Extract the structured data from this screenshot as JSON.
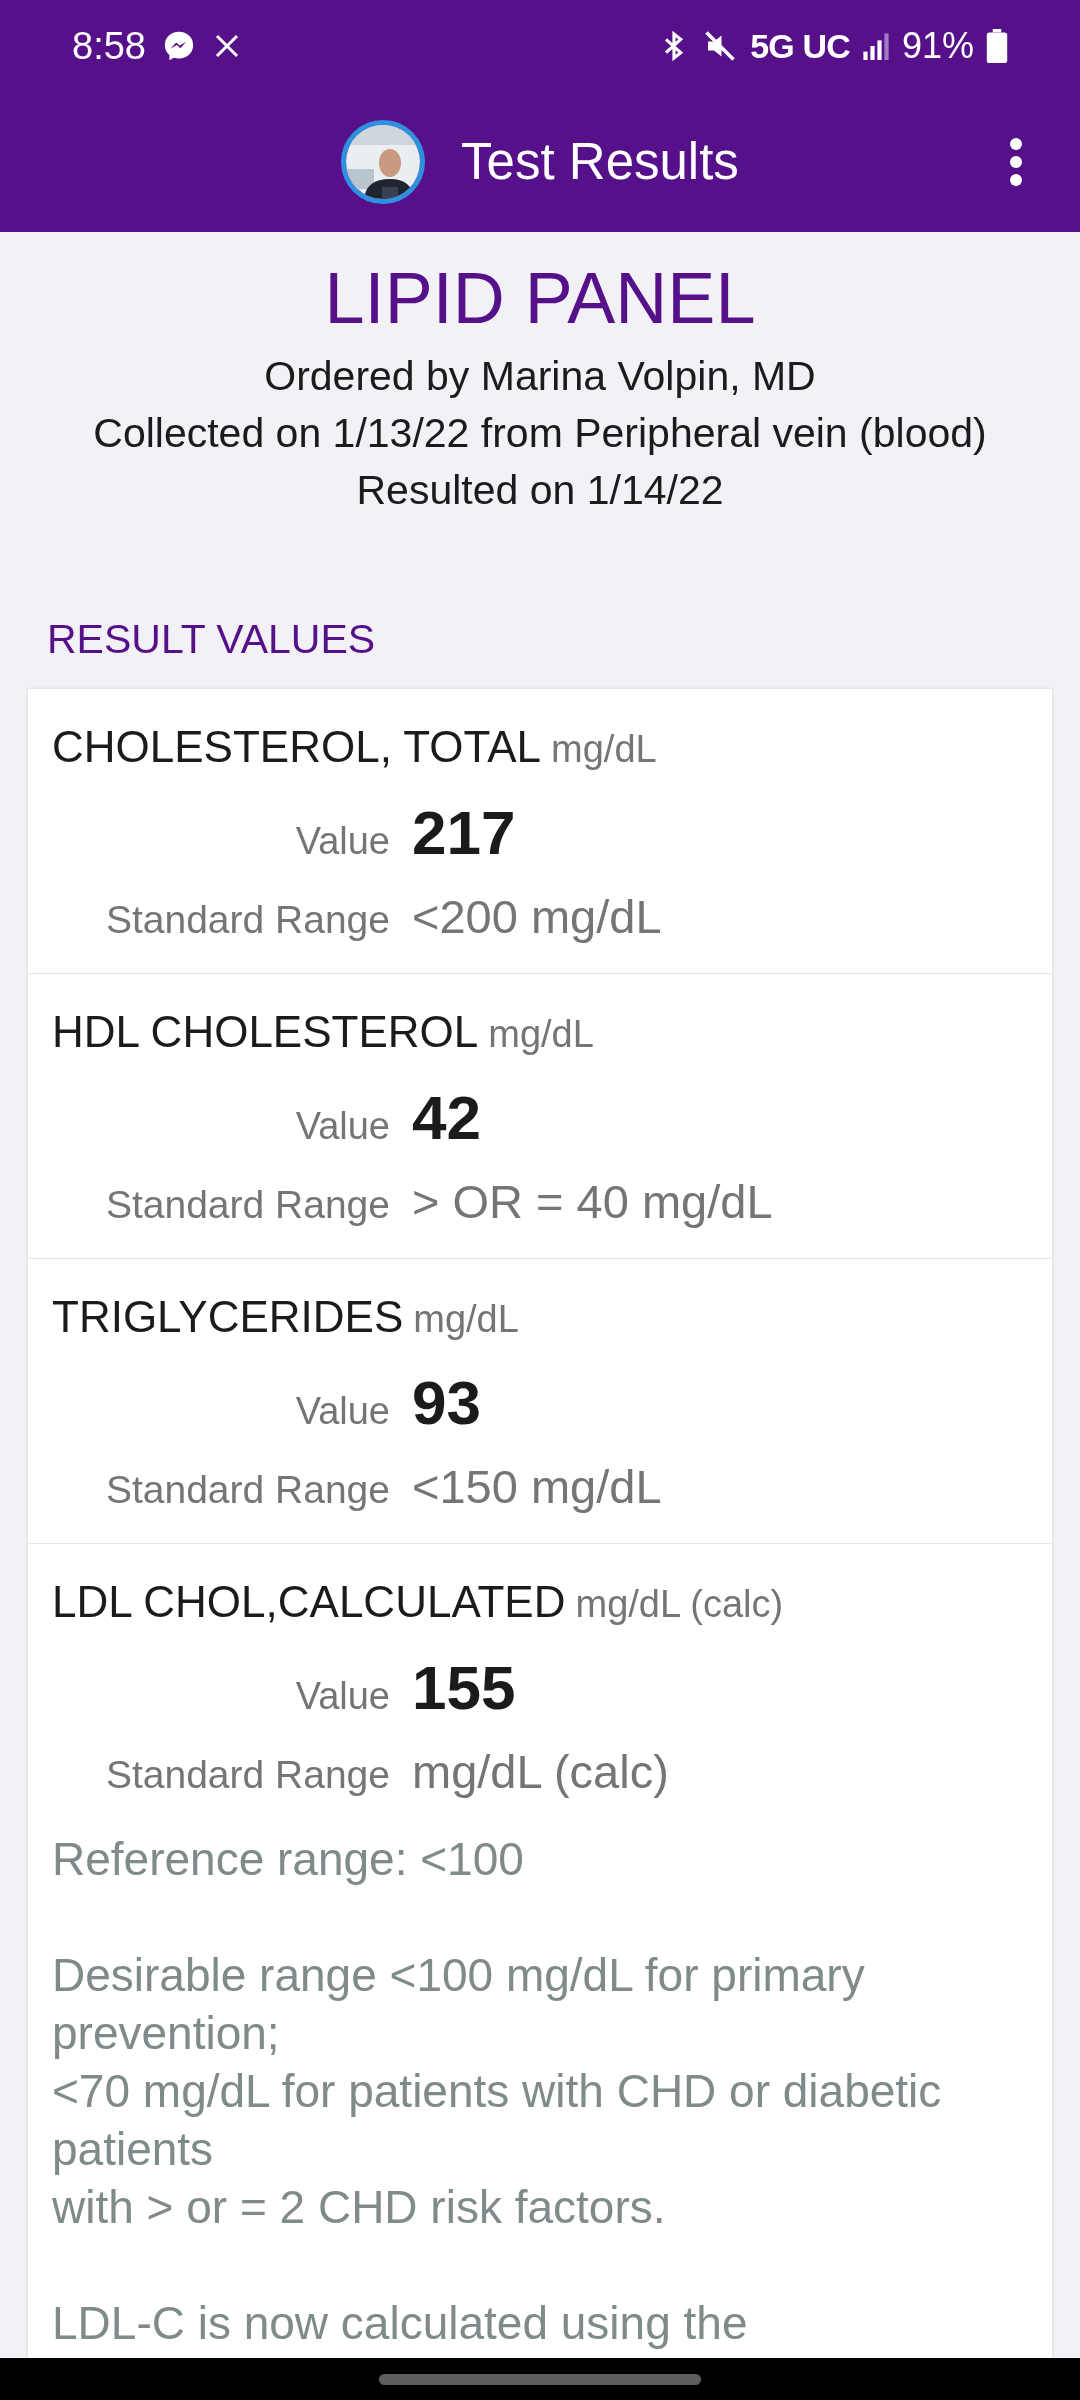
{
  "status_bar": {
    "time": "8:58",
    "network": "5G UC",
    "battery": "91%"
  },
  "app_bar": {
    "title": "Test Results"
  },
  "panel": {
    "title": "LIPID PANEL",
    "lines": [
      "Ordered by Marina Volpin, MD",
      "Collected on 1/13/22 from Peripheral vein (blood)",
      "Resulted on 1/14/22"
    ]
  },
  "section_heading": "RESULT VALUES",
  "results": [
    {
      "name": "CHOLESTEROL, TOTAL",
      "unit": "mg/dL",
      "value_label": "Value",
      "value": "217",
      "range_label": "Standard Range",
      "range": "<200 mg/dL"
    },
    {
      "name": "HDL CHOLESTEROL",
      "unit": "mg/dL",
      "value_label": "Value",
      "value": "42",
      "range_label": "Standard Range",
      "range": "> OR = 40 mg/dL"
    },
    {
      "name": "TRIGLYCERIDES",
      "unit": "mg/dL",
      "value_label": "Value",
      "value": "93",
      "range_label": "Standard Range",
      "range": "<150 mg/dL"
    },
    {
      "name": "LDL CHOL,CALCULATED",
      "unit": "mg/dL (calc)",
      "value_label": "Value",
      "value": "155",
      "range_label": "Standard Range",
      "range": "mg/dL (calc)",
      "notes": [
        "Reference range: <100",
        "Desirable range <100 mg/dL for primary prevention;\n<70 mg/dL for patients with CHD or diabetic patients\nwith > or = 2 CHD risk factors.",
        "LDL-C is now calculated using the"
      ]
    }
  ]
}
